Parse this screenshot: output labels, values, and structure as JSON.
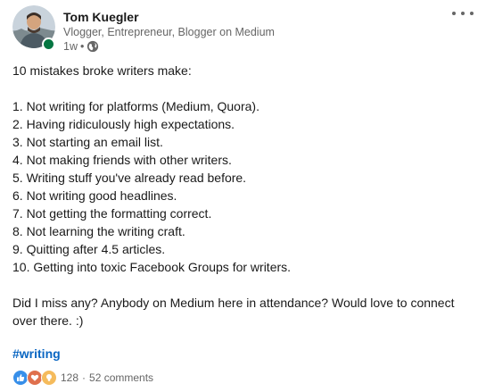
{
  "author": {
    "name": "Tom Kuegler",
    "headline": "Vlogger, Entrepreneur, Blogger on Medium",
    "time": "1w",
    "visibility_icon": "globe-icon",
    "presence_color": "#057642"
  },
  "post": {
    "intro": "10 mistakes broke writers make:",
    "items": [
      "1. Not writing for platforms (Medium, Quora).",
      "2. Having ridiculously high expectations.",
      "3. Not starting an email list.",
      "4. Not making friends with other writers.",
      "5. Writing stuff you've already read before.",
      "6. Not writing good headlines.",
      "7. Not getting the formatting correct.",
      "8. Not learning the writing craft.",
      "9. Quitting after 4.5 articles.",
      "10. Getting into toxic Facebook Groups for writers."
    ],
    "closing": "Did I miss any? Anybody on Medium here in attendance? Would love to connect over there. :)",
    "hashtag": "#writing"
  },
  "social": {
    "reaction_icons": [
      "like-icon",
      "love-icon",
      "insightful-icon"
    ],
    "reaction_count": "128",
    "separator": "·",
    "comments": "52 comments"
  },
  "menu": {
    "icon": "more-options-icon"
  },
  "colors": {
    "link": "#0a66c2",
    "like": "#378fe9",
    "love": "#df704d",
    "insightful": "#f5bb5c"
  }
}
